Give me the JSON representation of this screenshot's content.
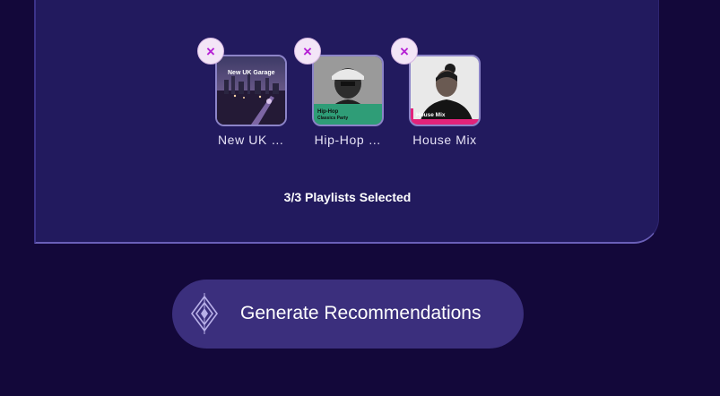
{
  "selected_playlists": [
    {
      "name": "New UK …",
      "cover_text": [
        "New UK Garage"
      ]
    },
    {
      "name": "Hip-Hop …",
      "cover_text": [
        "Hip-Hop",
        "Classics Party"
      ]
    },
    {
      "name": "House Mix",
      "cover_text": [
        "House Mix"
      ]
    }
  ],
  "remove_glyph": "×",
  "selection_count": "3/3 Playlists Selected",
  "generate_button": {
    "label": "Generate Recommendations",
    "icon": "diamond-sparkle-icon"
  },
  "colors": {
    "background": "#13083a",
    "panel": "#221a5e",
    "button": "#3b2f7d",
    "remove_accent": "#b51fd4"
  }
}
